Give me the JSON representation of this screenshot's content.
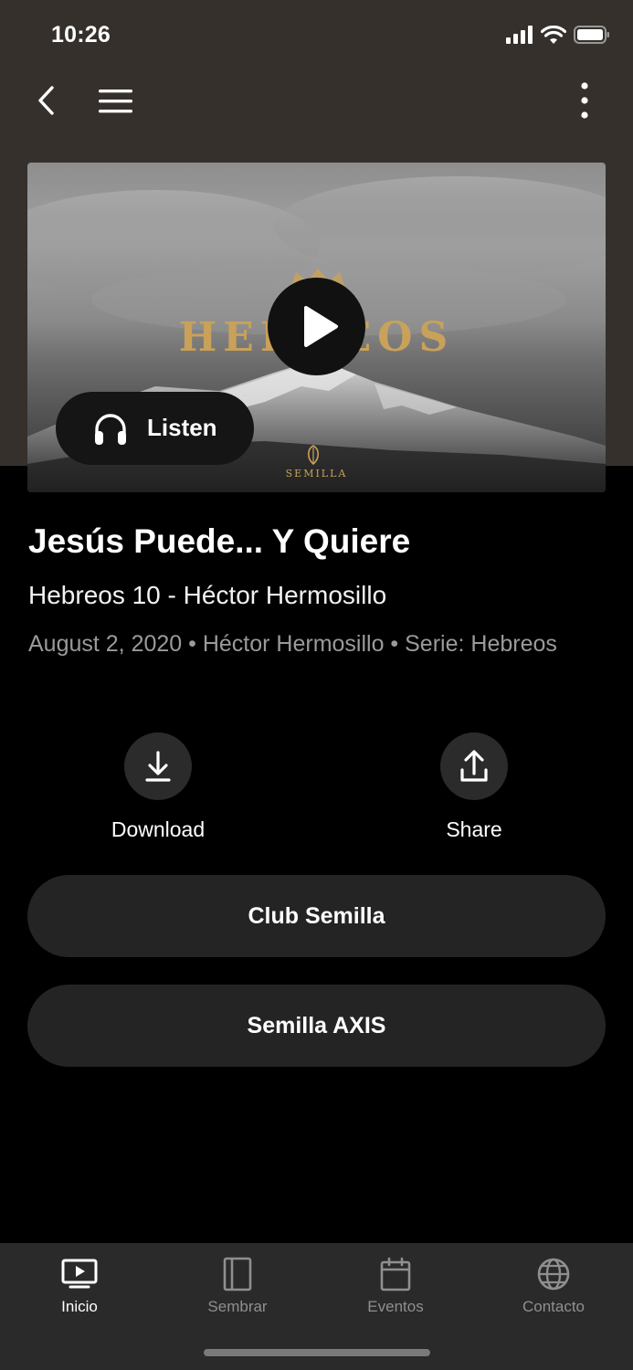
{
  "status_bar": {
    "time": "10:26",
    "icons": [
      "cellular-signal-icon",
      "wifi-icon",
      "battery-icon"
    ]
  },
  "nav": {
    "icons": [
      "back-chevron-icon",
      "hamburger-menu-icon",
      "more-vertical-icon"
    ]
  },
  "hero": {
    "artwork_title": "HEBREOS",
    "artwork_brand": "SEMILLA",
    "play_icon": "play-icon",
    "listen_label": "Listen",
    "listen_icon": "headphones-icon",
    "accent_color": "#c9a15a"
  },
  "sermon": {
    "title": "Jesús Puede... Y Quiere",
    "subtitle": "Hebreos 10 - Héctor Hermosillo",
    "meta": "August 2, 2020 • Héctor Hermosillo • Serie: Hebreos"
  },
  "actions": [
    {
      "label": "Download",
      "icon": "download-icon"
    },
    {
      "label": "Share",
      "icon": "share-icon"
    }
  ],
  "links": [
    {
      "label": "Club Semilla"
    },
    {
      "label": "Semilla AXIS"
    }
  ],
  "tabs": [
    {
      "label": "Inicio",
      "icon": "tv-play-icon",
      "active": true
    },
    {
      "label": "Sembrar",
      "icon": "book-icon",
      "active": false
    },
    {
      "label": "Eventos",
      "icon": "calendar-icon",
      "active": false
    },
    {
      "label": "Contacto",
      "icon": "globe-icon",
      "active": false
    }
  ],
  "colors": {
    "header_bg": "#35302c",
    "background": "#000000",
    "tabbar_bg": "#2a2a2a",
    "button_bg": "#242424"
  }
}
